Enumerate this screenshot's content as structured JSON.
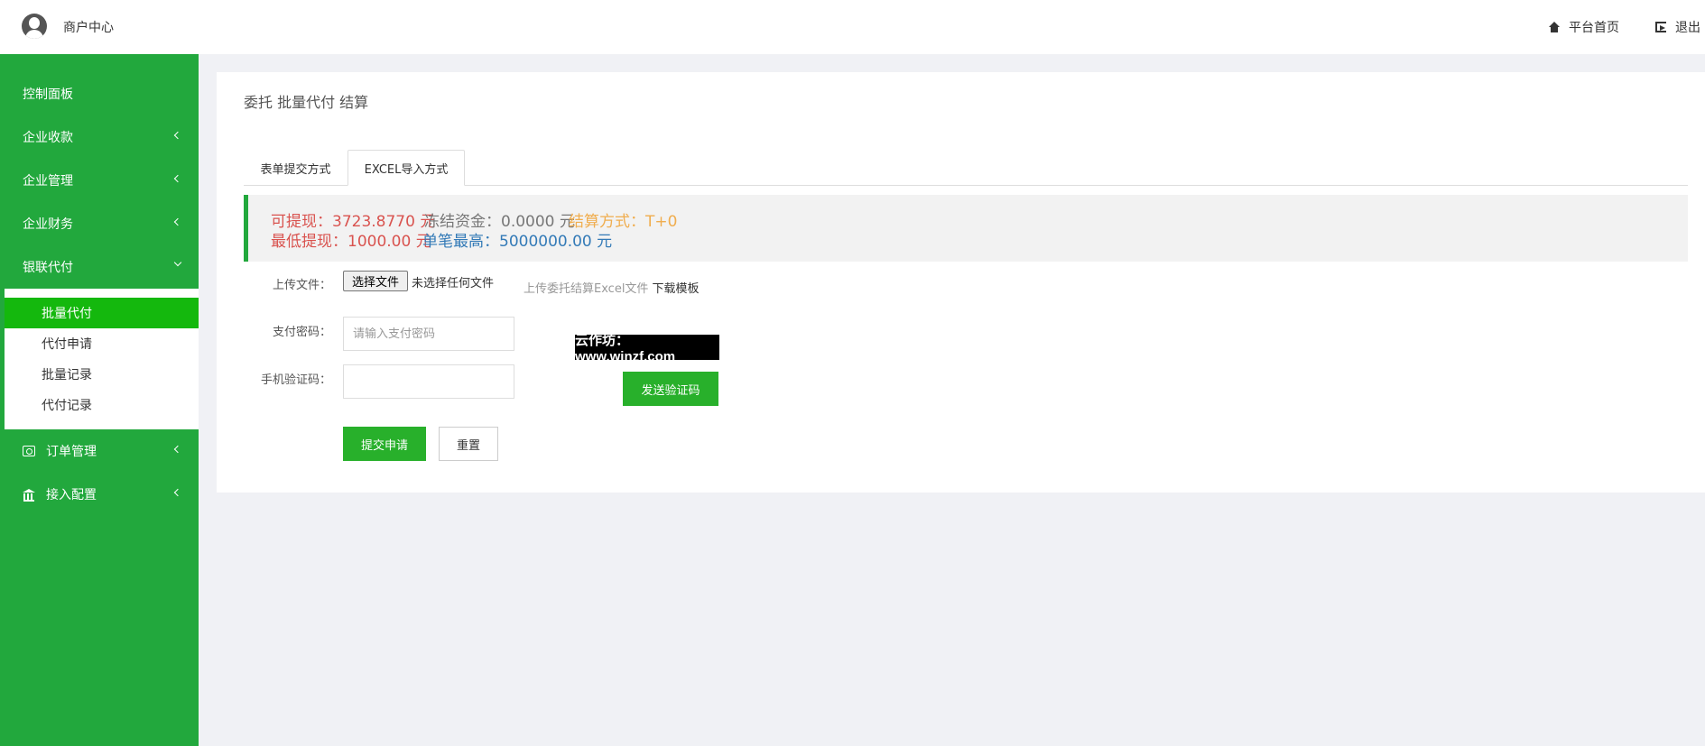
{
  "header": {
    "brand": "商户中心",
    "home_link": "平台首页",
    "logout_link": "退出"
  },
  "sidebar": {
    "items": [
      {
        "label": "控制面板"
      },
      {
        "label": "企业收款"
      },
      {
        "label": "企业管理"
      },
      {
        "label": "企业财务"
      },
      {
        "label": "银联代付"
      },
      {
        "label": "订单管理"
      },
      {
        "label": "接入配置"
      }
    ],
    "subitems": [
      {
        "label": "批量代付",
        "active": true
      },
      {
        "label": "代付申请"
      },
      {
        "label": "批量记录"
      },
      {
        "label": "代付记录"
      }
    ]
  },
  "main": {
    "title": "委托 批量代付 结算",
    "tabs": [
      {
        "label": "表单提交方式"
      },
      {
        "label": "EXCEL导入方式",
        "active": true
      }
    ],
    "balance": {
      "withdrawable_label": "可提现：",
      "withdrawable_value": "3723.8770 元",
      "frozen_label": "冻结资金：",
      "frozen_value": "0.0000 元",
      "settle_label": "结算方式：",
      "settle_value": "T+0",
      "min_label": "最低提现：",
      "min_value": "1000.00 元",
      "max_label": "单笔最高：",
      "max_value": "5000000.00 元"
    },
    "form": {
      "upload_label": "上传文件：",
      "file_button": "选择文件",
      "file_status": "未选择任何文件",
      "upload_help": "上传委托结算Excel文件",
      "download_template": "下载模板",
      "password_label": "支付密码：",
      "password_placeholder": "请输入支付密码",
      "sms_label": "手机验证码：",
      "sms_value": "",
      "send_code_button": "发送验证码",
      "submit_button": "提交申请",
      "reset_button": "重置"
    },
    "watermark": "云作坊：www.winzf.com"
  },
  "colors": {
    "sidebar": "#22a83d",
    "active_subitem": "#14b80d",
    "button_green": "#28b02b",
    "red": "#d9534f",
    "orange": "#f0ad4e",
    "blue": "#337ab7"
  }
}
